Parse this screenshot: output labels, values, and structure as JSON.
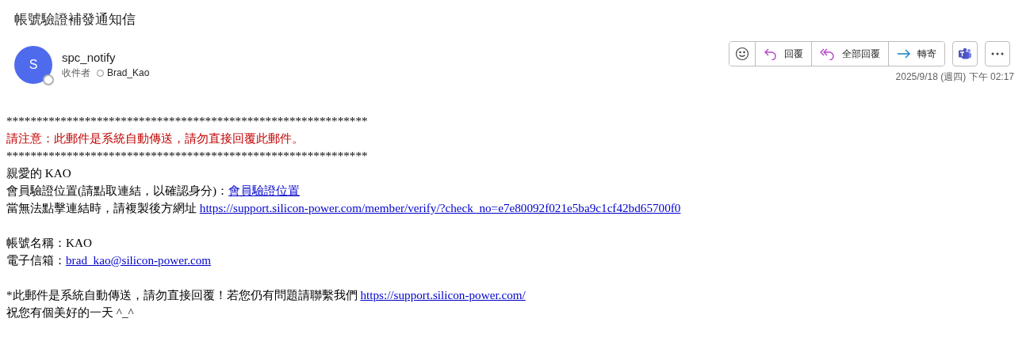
{
  "subject": "帳號驗證補發通知信",
  "sender": {
    "avatar": "S",
    "name": "spc_notify",
    "to_label": "收件者",
    "recipient": "Brad_Kao"
  },
  "actions": [
    {
      "kind": "emoji"
    },
    {
      "kind": "reply",
      "label": "回覆"
    },
    {
      "kind": "reply_all",
      "label": "全部回覆"
    },
    {
      "kind": "forward",
      "label": "轉寄"
    }
  ],
  "extra_buttons": [
    {
      "kind": "teams"
    },
    {
      "kind": "more"
    }
  ],
  "date": "2025/9/18 (週四) 下午 02:17",
  "body": [
    {
      "kind": "rule",
      "parts": [
        {
          "text": "************************************************************"
        }
      ]
    },
    {
      "kind": "warning",
      "parts": [
        {
          "text": "請注意：此郵件是系統自動傳送，請勿直接回覆此郵件。"
        }
      ]
    },
    {
      "kind": "rule",
      "parts": [
        {
          "text": "************************************************************"
        }
      ]
    },
    {
      "kind": "text",
      "parts": [
        {
          "text": "親愛的 KAO"
        }
      ]
    },
    {
      "kind": "text",
      "parts": [
        {
          "text": "會員驗證位置(請點取連結，以確認身分)："
        },
        {
          "text": "會員驗證位置",
          "link": true
        }
      ]
    },
    {
      "kind": "text",
      "parts": [
        {
          "text": "當無法點擊連結時，請複製後方網址 "
        },
        {
          "text": "https://support.silicon-power.com/member/verify/?check_no=e7e80092f021e5ba9c1cf42bd65700f0",
          "link": true
        }
      ]
    },
    {
      "kind": "blank"
    },
    {
      "kind": "text",
      "parts": [
        {
          "text": "帳號名稱：KAO"
        }
      ]
    },
    {
      "kind": "text",
      "parts": [
        {
          "text": "電子信箱："
        },
        {
          "text": "brad_kao@silicon-power.com",
          "link": true
        }
      ]
    },
    {
      "kind": "blank"
    },
    {
      "kind": "text",
      "parts": [
        {
          "text": "*此郵件是系統自動傳送，請勿直接回覆！若您仍有問題請聯繫我們 "
        },
        {
          "text": "https://support.silicon-power.com/",
          "link": true
        }
      ]
    },
    {
      "kind": "text",
      "parts": [
        {
          "text": "祝您有個美好的一天 ^_^"
        }
      ]
    }
  ]
}
